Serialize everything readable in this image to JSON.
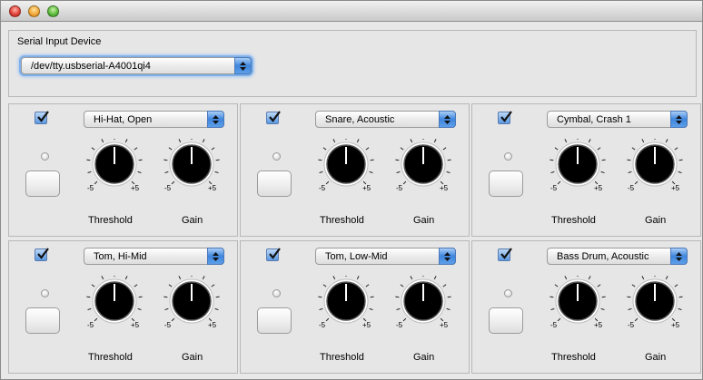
{
  "window": {
    "controls": [
      "close-icon",
      "minimize-icon",
      "zoom-icon"
    ]
  },
  "serial": {
    "label": "Serial Input Device",
    "device": "/dev/tty.usbserial-A4001qi4"
  },
  "pads": [
    {
      "enabled": true,
      "instrument": "Hi-Hat, Open",
      "threshold_label": "Threshold",
      "gain_label": "Gain",
      "min_label": "-5",
      "max_label": "+5"
    },
    {
      "enabled": true,
      "instrument": "Snare, Acoustic",
      "threshold_label": "Threshold",
      "gain_label": "Gain",
      "min_label": "-5",
      "max_label": "+5"
    },
    {
      "enabled": true,
      "instrument": "Cymbal, Crash 1",
      "threshold_label": "Threshold",
      "gain_label": "Gain",
      "min_label": "-5",
      "max_label": "+5"
    },
    {
      "enabled": true,
      "instrument": "Tom, Hi-Mid",
      "threshold_label": "Threshold",
      "gain_label": "Gain",
      "min_label": "-5",
      "max_label": "+5"
    },
    {
      "enabled": true,
      "instrument": "Tom, Low-Mid",
      "threshold_label": "Threshold",
      "gain_label": "Gain",
      "min_label": "-5",
      "max_label": "+5"
    },
    {
      "enabled": true,
      "instrument": "Bass Drum, Acoustic",
      "threshold_label": "Threshold",
      "gain_label": "Gain",
      "min_label": "-5",
      "max_label": "+5"
    }
  ],
  "knob_value": 0,
  "colors": {
    "accent": "#3e86dd",
    "knob": "#000000"
  }
}
